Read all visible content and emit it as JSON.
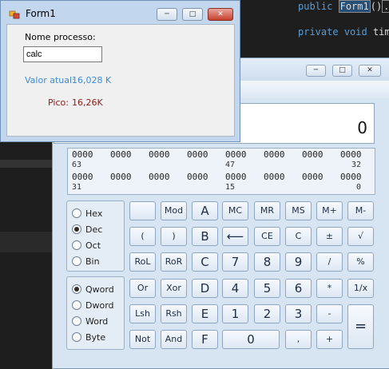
{
  "editor": {
    "line1": {
      "kw": "public",
      "method": "Form1",
      "rest": "()",
      "ell": "..."
    },
    "line2": {
      "kw": "private",
      "type": "void",
      "name": "time"
    }
  },
  "form1": {
    "title": "Form1",
    "process_label": "Nome processo:",
    "process_value": "calc",
    "current_label": "Valor atual:",
    "current_value": "16,028 K",
    "peak_label": "Pico:",
    "peak_value": "16,26K",
    "colors": {
      "current": "#3b8ad9",
      "peak": "#8b1a1a"
    }
  },
  "calculator": {
    "display": "0",
    "bits": {
      "row1": [
        "0000",
        "0000",
        "0000",
        "0000",
        "0000",
        "0000",
        "0000",
        "0000"
      ],
      "row1_labels": [
        "63",
        "47",
        "32"
      ],
      "row2": [
        "0000",
        "0000",
        "0000",
        "0000",
        "0000",
        "0000",
        "0000",
        "0000"
      ],
      "row2_labels": [
        "31",
        "15",
        "0"
      ]
    },
    "base_options": [
      "Hex",
      "Dec",
      "Oct",
      "Bin"
    ],
    "base_selected": "Dec",
    "word_options": [
      "Qword",
      "Dword",
      "Word",
      "Byte"
    ],
    "word_selected": "Qword",
    "buttons": {
      "r1": [
        "",
        "Mod",
        "A",
        "MC",
        "MR",
        "MS",
        "M+",
        "M-"
      ],
      "r2": [
        "(",
        ")",
        "B",
        "⟵",
        "CE",
        "C",
        "±",
        "√"
      ],
      "r3": [
        "RoL",
        "RoR",
        "C",
        "7",
        "8",
        "9",
        "/",
        "%"
      ],
      "r4": [
        "Or",
        "Xor",
        "D",
        "4",
        "5",
        "6",
        "*",
        "1/x"
      ],
      "r5": [
        "Lsh",
        "Rsh",
        "E",
        "1",
        "2",
        "3",
        "-",
        "="
      ],
      "r6": [
        "Not",
        "And",
        "F",
        "0",
        ",",
        "+"
      ]
    }
  }
}
